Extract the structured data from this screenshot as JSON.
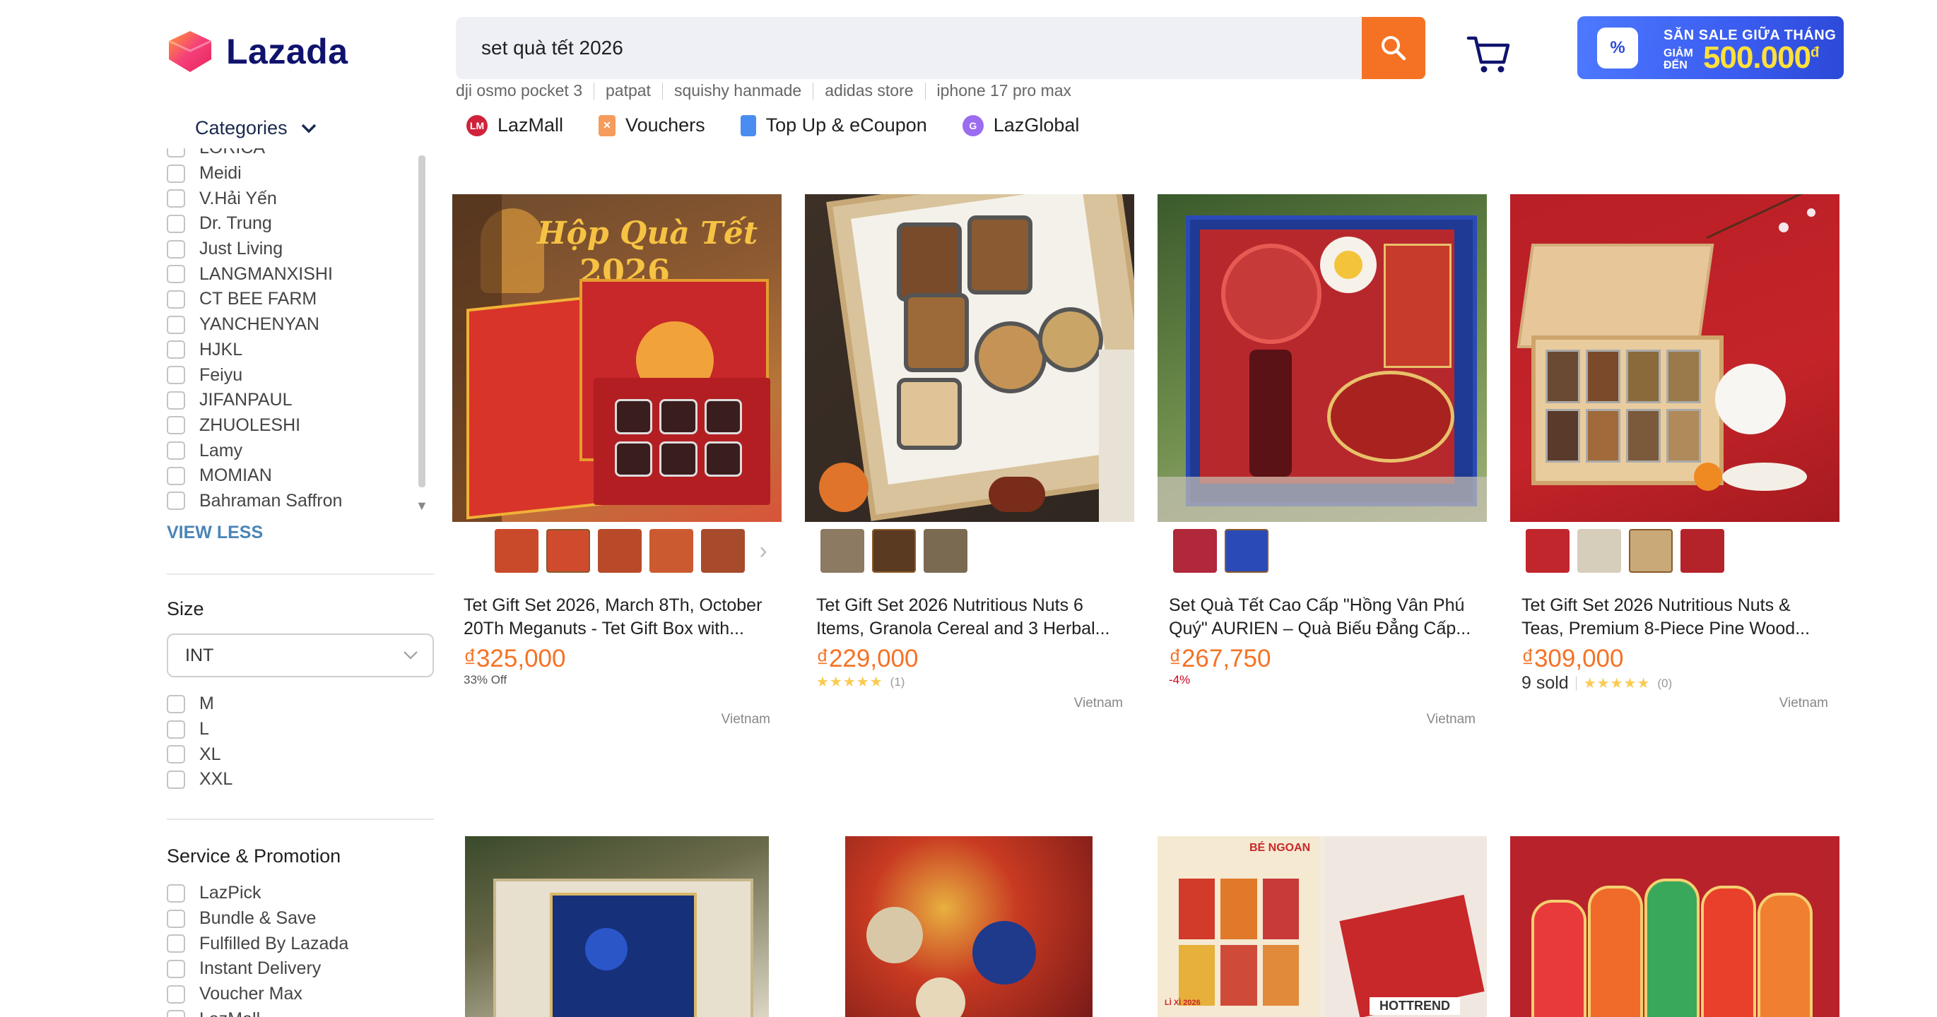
{
  "header": {
    "logo_text": "Lazada",
    "search_value": "set quà tết 2026",
    "suggestions": [
      "dji osmo pocket 3",
      "patpat",
      "squishy hanmade",
      "adidas store",
      "iphone 17 pro max"
    ],
    "nav": [
      {
        "label": "LazMall",
        "icon": "lazmall-icon"
      },
      {
        "label": "Vouchers",
        "icon": "voucher-icon"
      },
      {
        "label": "Top Up & eCoupon",
        "icon": "topup-icon"
      },
      {
        "label": "LazGlobal",
        "icon": "lazglobal-icon"
      }
    ],
    "promo": {
      "line1": "SĂN SALE GIỮA THÁNG",
      "line2": "GIẢM ĐẾN",
      "amount": "500.000",
      "currency": "đ",
      "badge": "%"
    }
  },
  "sidebar": {
    "categories_label": "Categories",
    "brands": [
      "LORICA",
      "Meidi",
      "V.Hải Yến",
      "Dr. Trung",
      "Just Living",
      "LANGMANXISHI",
      "CT BEE FARM",
      "YANCHENYAN",
      "HJKL",
      "Feiyu",
      "JIFANPAUL",
      "ZHUOLESHI",
      "Lamy",
      "MOMIAN",
      "Bahraman Saffron"
    ],
    "view_less": "VIEW LESS",
    "size_title": "Size",
    "size_select": "INT",
    "sizes": [
      "M",
      "L",
      "XL",
      "XXL"
    ],
    "service_title": "Service & Promotion",
    "services": [
      "LazPick",
      "Bundle & Save",
      "Fulfilled By Lazada",
      "Instant Delivery",
      "Voucher Max",
      "LazMall"
    ]
  },
  "products": [
    {
      "title": "Tet Gift Set 2026, March 8Th, October 20Th Meganuts - Tet Gift Box with...",
      "price": "₫325,000",
      "discount": "33% Off",
      "country": "Vietnam",
      "img_text1": "Hộp Quà Tết",
      "img_text2": "2026"
    },
    {
      "title": "Tet Gift Set 2026 Nutritious Nuts 6 Items, Granola Cereal and 3 Herbal...",
      "price": "₫229,000",
      "stars": "★★★★★",
      "reviews": "(1)",
      "country": "Vietnam"
    },
    {
      "title": "Set Quà Tết Cao Cấp \"Hồng Vân Phú Quý\" AURIEN – Quà Biếu Đẳng Cấp...",
      "price": "₫267,750",
      "discount": "-4%",
      "country": "Vietnam"
    },
    {
      "title": "Tet Gift Set 2026 Nutritious Nuts & Teas, Premium 8-Piece Pine Wood...",
      "price": "₫309,000",
      "sold": "9 sold",
      "stars": "★★★★★",
      "reviews": "(0)",
      "country": "Vietnam"
    }
  ],
  "row2": {
    "img3_tag1": "BÉ NGOAN",
    "img3_tag2": "HOTTREND",
    "img3_tag3": "LÌ XÌ 2026"
  },
  "colors": {
    "accent": "#f57224",
    "brand": "#0f136d",
    "promo": "#3a5cf0"
  }
}
